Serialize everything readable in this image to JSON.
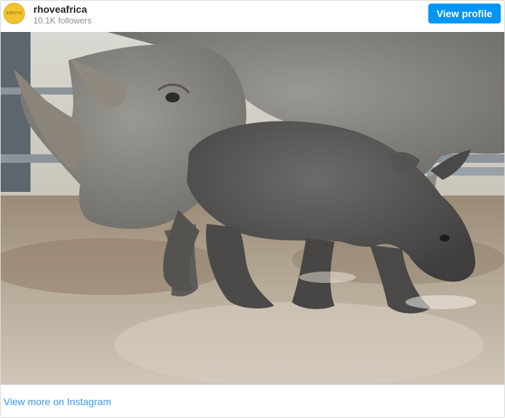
{
  "header": {
    "avatar_text": "RHOVE",
    "username": "rhoveafrica",
    "followers": "10.1K followers",
    "view_profile_label": "View profile"
  },
  "post": {
    "image_description_icon": "rhino-photo",
    "colors": {
      "accent": "#0095f6",
      "link": "#3897f0",
      "avatar": "#f2c230"
    }
  },
  "footer": {
    "view_more_label": "View more on Instagram"
  }
}
